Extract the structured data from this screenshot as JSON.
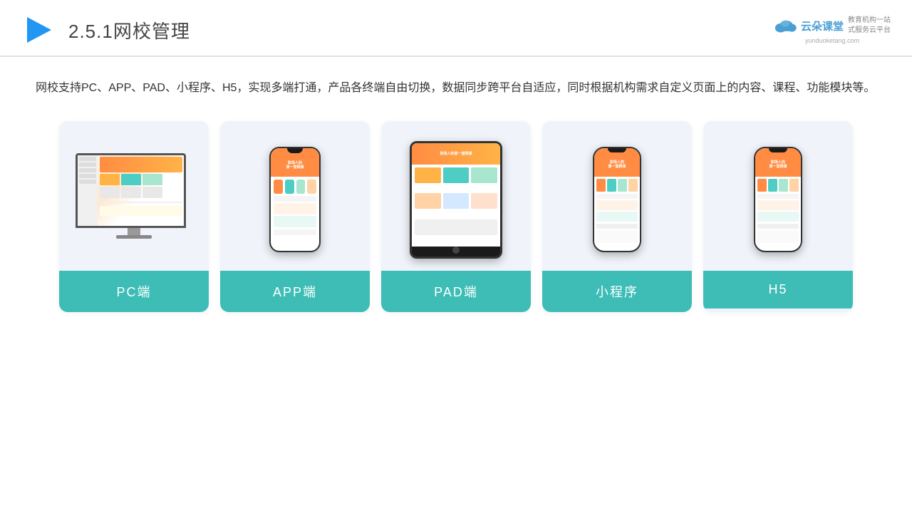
{
  "header": {
    "section": "2.5.1",
    "title": "网校管理",
    "brand_name": "云朵课堂",
    "brand_slogan_line1": "教育机构一站",
    "brand_slogan_line2": "式服务云平台",
    "brand_url": "yunduoketang.com"
  },
  "description": {
    "text": "网校支持PC、APP、PAD、小程序、H5，实现多端打通，产品各终端自由切换，数据同步跨平台自适应，同时根据机构需求自定义页面上的内容、课程、功能模块等。"
  },
  "cards": [
    {
      "id": "pc",
      "label": "PC端"
    },
    {
      "id": "app",
      "label": "APP端"
    },
    {
      "id": "pad",
      "label": "PAD端"
    },
    {
      "id": "miniprogram",
      "label": "小程序"
    },
    {
      "id": "h5",
      "label": "H5"
    }
  ],
  "colors": {
    "teal": "#3dbdb5",
    "accent_orange": "#ff8c42",
    "bg_card": "#eef2f9",
    "header_border": "#e0e0e0",
    "brand_blue": "#4a9fd4"
  }
}
